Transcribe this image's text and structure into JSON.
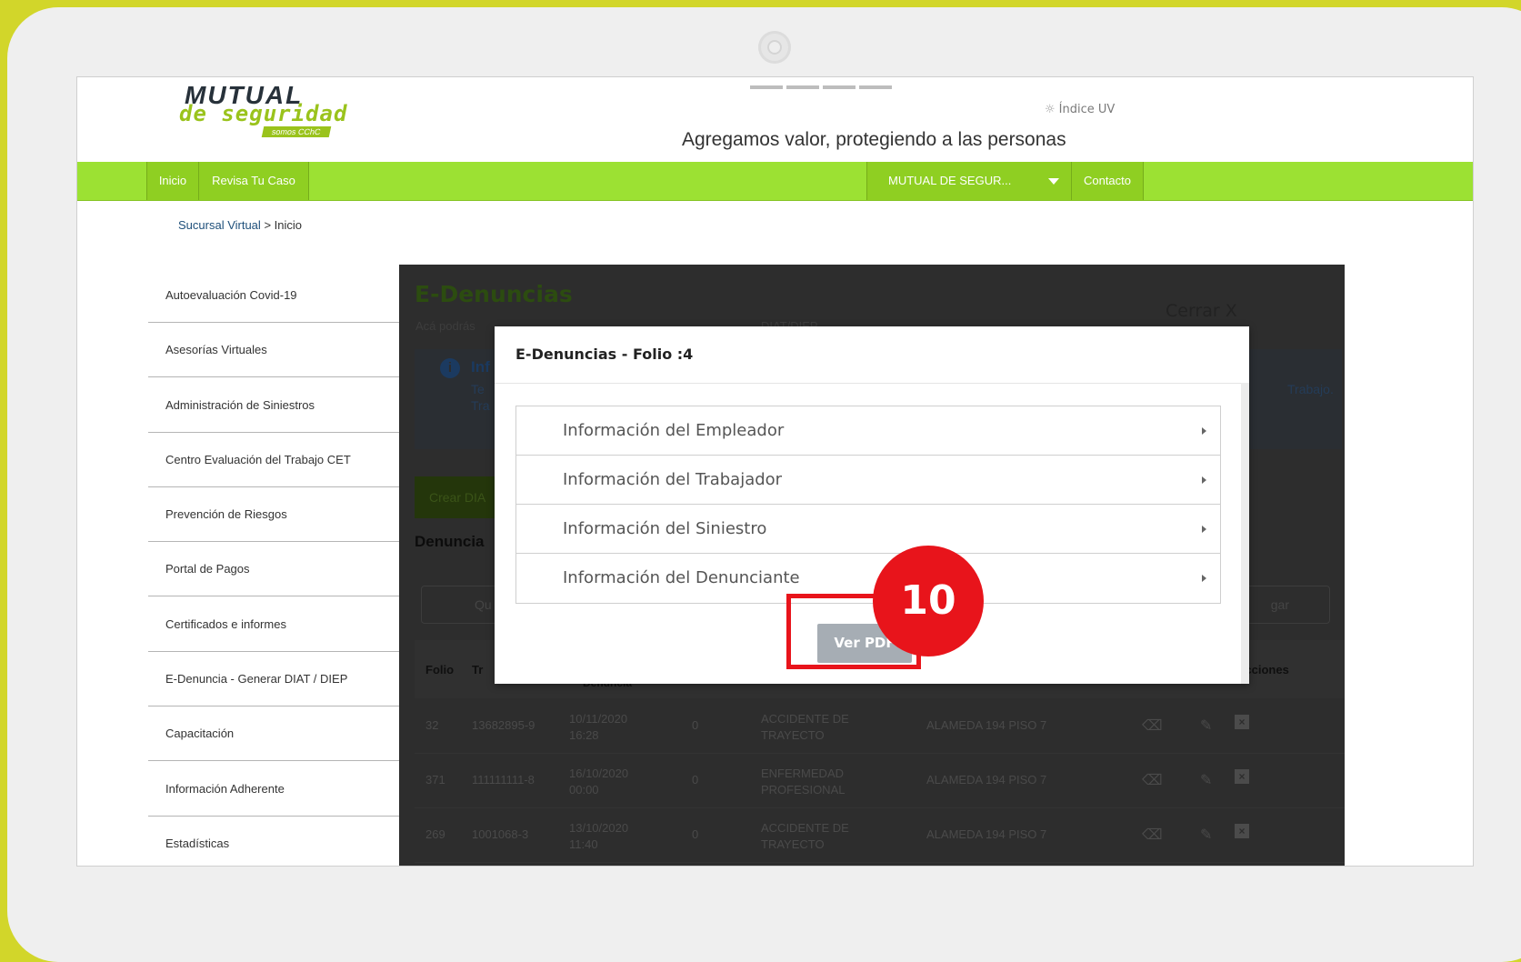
{
  "header": {
    "logo_main": "MUTUAL",
    "logo_sub": "de seguridad",
    "logo_tag": "somos CChC",
    "indice_label": "Índice UV",
    "tagline": "Agregamos valor, protegiendo a las personas"
  },
  "nav": {
    "inicio": "Inicio",
    "revisa": "Revisa Tu Caso",
    "company_select": "MUTUAL DE SEGUR...",
    "contacto": "Contacto"
  },
  "breadcrumb": {
    "link": "Sucursal Virtual",
    "separator": ">",
    "current": "Inicio"
  },
  "sidebar": {
    "items": [
      "Autoevaluación Covid-19",
      "Asesorías Virtuales",
      "Administración de Siniestros",
      "Centro Evaluación del Trabajo CET",
      "Prevención de Riesgos",
      "Portal de Pagos",
      "Certificados e informes",
      "E-Denuncia - Generar DIAT / DIEP",
      "Capacitación",
      "Información Adherente",
      "Estadísticas"
    ]
  },
  "panel": {
    "title": "E-Denuncias",
    "subtitle": "Acá podrás",
    "subtitle_right": "DIAT/DIEP",
    "close_label": "Cerrar X",
    "info_title": "Inf",
    "info_line1": "Te",
    "info_line2": "Tra",
    "info_right": "Trabajo.",
    "create_button": "Crear DIA",
    "list_label": "Denuncia",
    "search_hint": "Qu",
    "search_right": "gar",
    "table": {
      "headers": {
        "folio": "Folio",
        "tr": "Tr",
        "denuncia": "Denuncia",
        "acciones": "Acciones"
      },
      "rows": [
        {
          "folio": "32",
          "rut": "13682895-9",
          "date": "10/11/2020",
          "time": "16:28",
          "count": "0",
          "type1": "ACCIDENTE DE",
          "type2": "TRAYECTO",
          "address": "ALAMEDA 194 PISO 7"
        },
        {
          "folio": "371",
          "rut": "111111111-8",
          "date": "16/10/2020",
          "time": "00:00",
          "count": "0",
          "type1": "ENFERMEDAD",
          "type2": "PROFESIONAL",
          "address": "ALAMEDA 194 PISO 7"
        },
        {
          "folio": "269",
          "rut": "1001068-3",
          "date": "13/10/2020",
          "time": "11:40",
          "count": "0",
          "type1": "ACCIDENTE DE",
          "type2": "TRAYECTO",
          "address": "ALAMEDA 194 PISO 7"
        }
      ]
    }
  },
  "modal": {
    "title": "E-Denuncias - Folio :4",
    "sections": [
      "Información del Empleador",
      "Información del Trabajador",
      "Información del Siniestro",
      "Información del Denunciante"
    ],
    "button": "Ver PDF"
  },
  "annotation": {
    "step_number": "10",
    "color": "#e8141b"
  },
  "colors": {
    "frame": "#d2d62a",
    "nav_green": "#9ce133",
    "brand_green": "#9ac31c"
  }
}
